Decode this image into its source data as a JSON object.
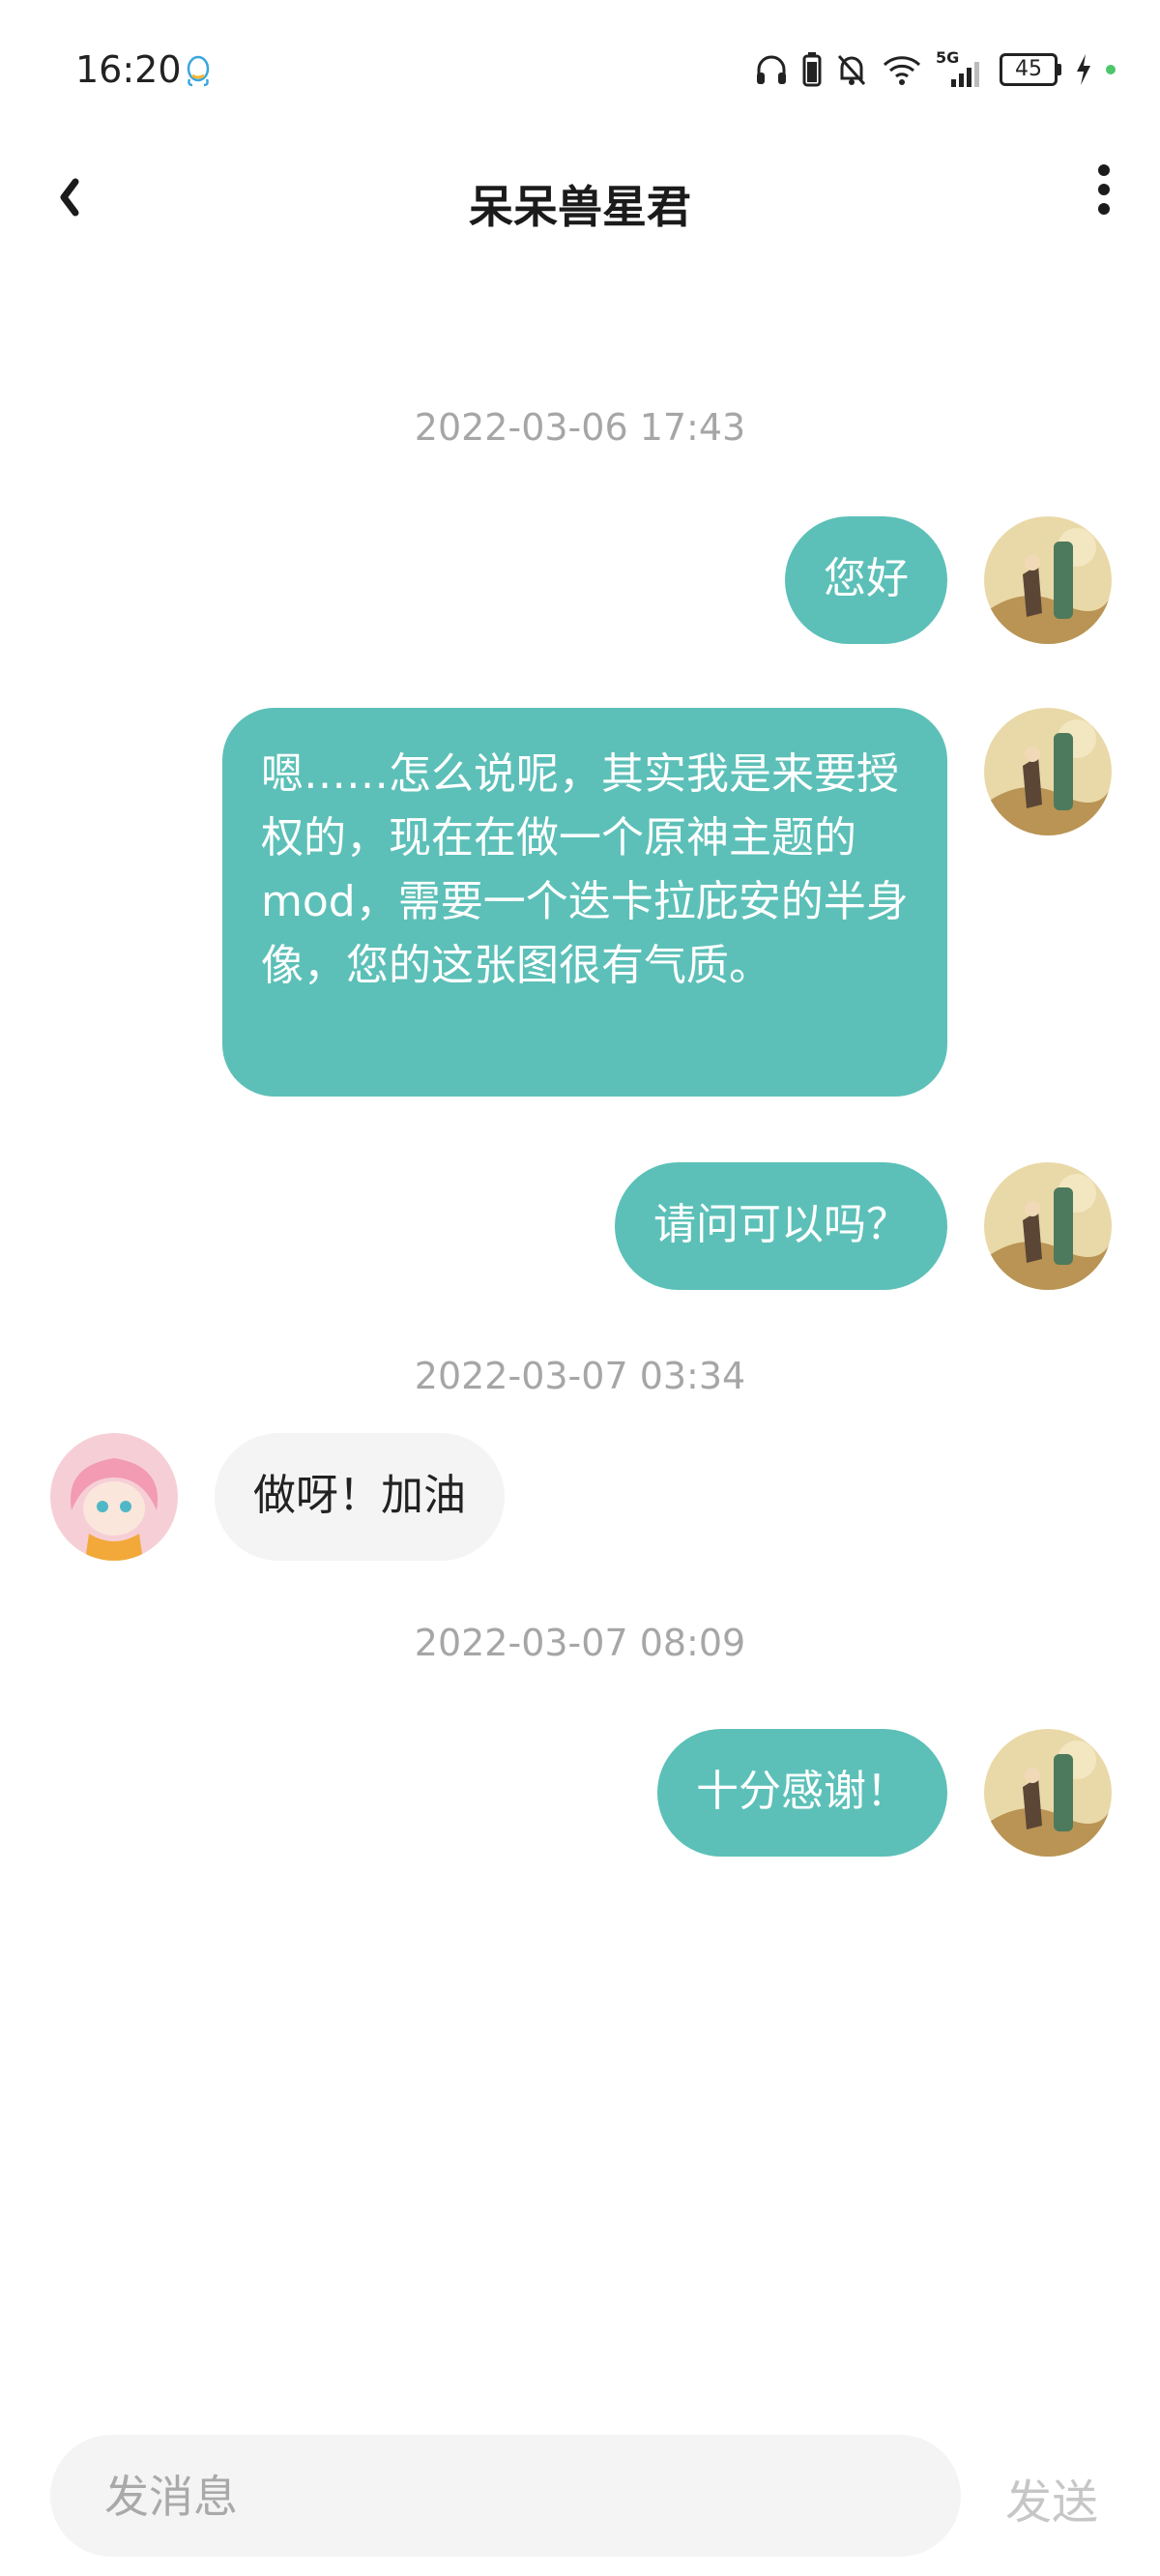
{
  "status_bar": {
    "time": "16:20",
    "network": "5G",
    "battery": "45",
    "icons": [
      "qq-icon",
      "headphones-icon",
      "battery-small-icon",
      "bell-off-icon",
      "wifi-icon",
      "signal-icon",
      "charging-icon",
      "notification-dot-icon"
    ]
  },
  "header": {
    "title": "呆呆兽星君",
    "back_icon": "chevron-left-icon",
    "more_icon": "more-vertical-icon"
  },
  "conversation": {
    "timestamps": [
      "2022-03-06 17:43",
      "2022-03-07 03:34",
      "2022-03-07 08:09"
    ],
    "messages": [
      {
        "side": "out",
        "text": "您好"
      },
      {
        "side": "out",
        "text": "嗯……怎么说呢，其实我是来要授权的，现在在做一个原神主题的mod，需要一个迭卡拉庇安的半身像，您的这张图很有气质。"
      },
      {
        "side": "out",
        "text": "请问可以吗？"
      },
      {
        "side": "in",
        "text": "做呀！加油"
      },
      {
        "side": "out",
        "text": "十分感谢！"
      }
    ]
  },
  "composer": {
    "placeholder": "发消息",
    "send_label": "发送"
  },
  "colors": {
    "outgoing_bubble": "#5cc0b8",
    "incoming_bubble": "#f4f4f4",
    "timestamp": "#a6a6a6",
    "send_disabled": "#c6c6c6"
  }
}
